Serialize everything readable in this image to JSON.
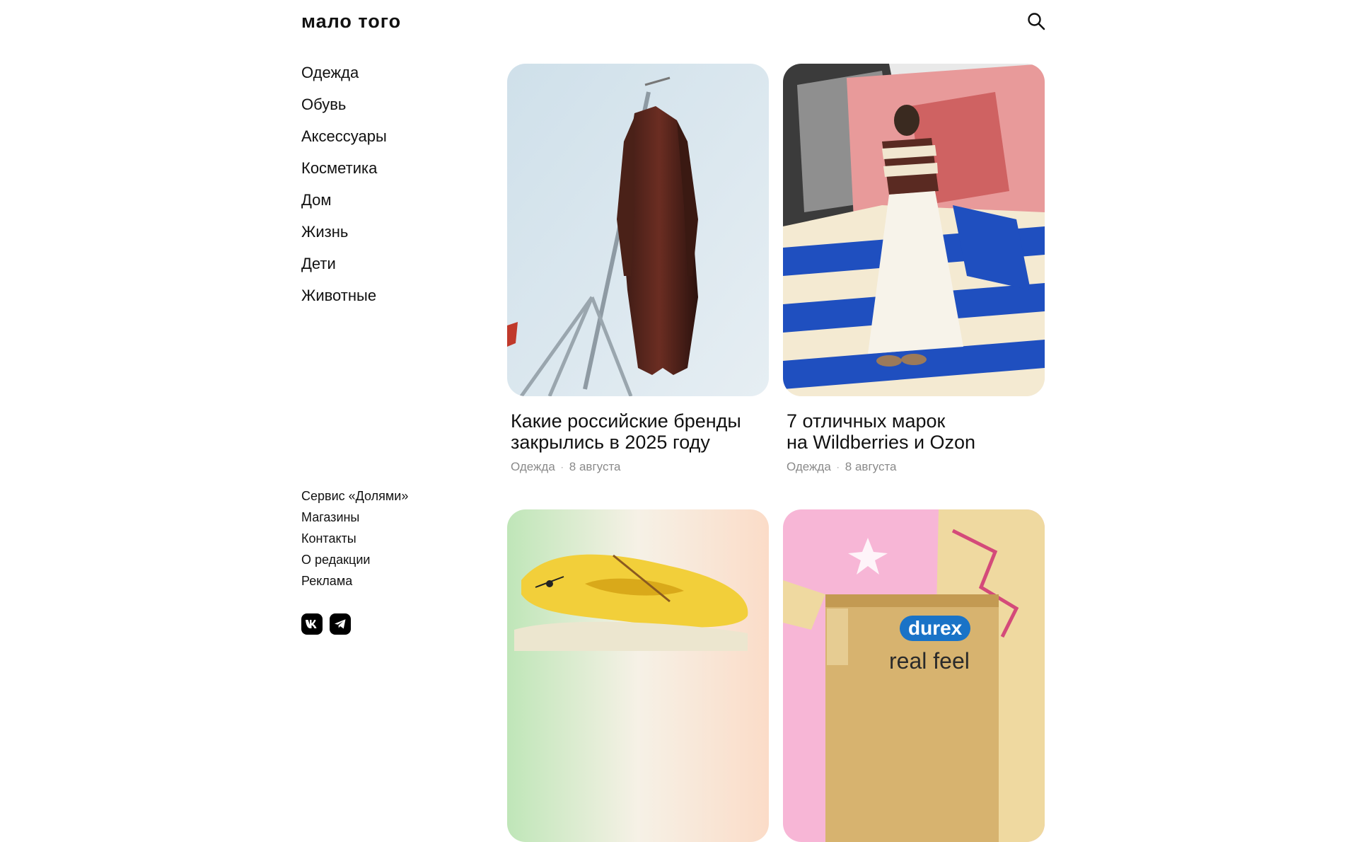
{
  "header": {
    "logo_text": "мало того",
    "search_icon": "search-icon"
  },
  "nav": {
    "items": [
      {
        "label": "Одежда"
      },
      {
        "label": "Обувь"
      },
      {
        "label": "Аксессуары"
      },
      {
        "label": "Косметика"
      },
      {
        "label": "Дом"
      },
      {
        "label": "Жизнь"
      },
      {
        "label": "Дети"
      },
      {
        "label": "Животные"
      }
    ]
  },
  "footer": {
    "links": [
      {
        "label": "Сервис «Долями»"
      },
      {
        "label": "Магазины"
      },
      {
        "label": "Контакты"
      },
      {
        "label": "О редакции"
      },
      {
        "label": "Реклама"
      }
    ],
    "social": [
      {
        "icon": "vk-icon"
      },
      {
        "icon": "telegram-icon"
      }
    ]
  },
  "articles": [
    {
      "title_line1": "Какие российские бренды",
      "title_line2": "закрылись в 2025 году",
      "category": "Одежда",
      "date": "8 августа",
      "image": "leather-coat-on-stand"
    },
    {
      "title_line1": "7 отличных марок",
      "title_line2": "на Wildberries и Ozon",
      "category": "Одежда",
      "date": "8 августа",
      "image": "striped-polo-collage"
    },
    {
      "image": "yellow-clogs",
      "title_line1": "",
      "title_line2": "",
      "category": "",
      "date": ""
    },
    {
      "image": "durex-box-pink-collage",
      "image_text_1": "durex",
      "image_text_2": "real feel",
      "title_line1": "",
      "title_line2": "",
      "category": "",
      "date": ""
    }
  ]
}
